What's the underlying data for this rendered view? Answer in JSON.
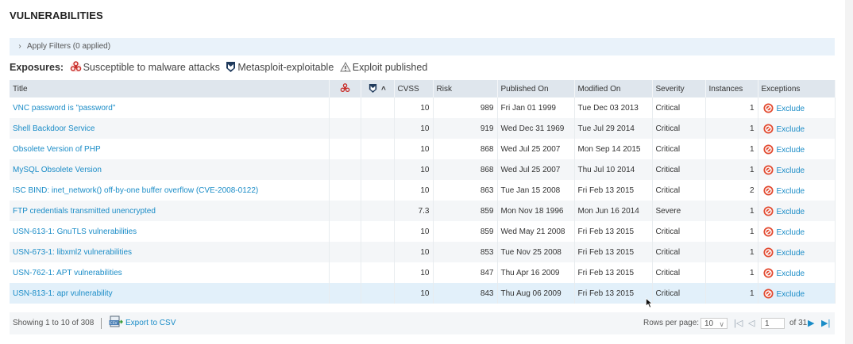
{
  "page": {
    "title": "VULNERABILITIES"
  },
  "filters": {
    "label": "Apply Filters (0 applied)"
  },
  "exposures": {
    "label": "Exposures:",
    "items": [
      {
        "icon": "malware-icon",
        "label": "Susceptible to malware attacks"
      },
      {
        "icon": "metasploit-icon",
        "label": "Metasploit-exploitable"
      },
      {
        "icon": "exploit-icon",
        "label": "Exploit published"
      }
    ]
  },
  "table": {
    "headers": {
      "title": "Title",
      "malware": "",
      "metasploit": "^",
      "cvss": "CVSS",
      "risk": "Risk",
      "published": "Published On",
      "modified": "Modified On",
      "severity": "Severity",
      "instances": "Instances",
      "exceptions": "Exceptions"
    },
    "rows": [
      {
        "title": "VNC password is \"password\"",
        "cvss": "10",
        "risk": "989",
        "published": "Fri Jan 01 1999",
        "modified": "Tue Dec 03 2013",
        "severity": "Critical",
        "instances": "1",
        "exception": "Exclude"
      },
      {
        "title": "Shell Backdoor Service",
        "cvss": "10",
        "risk": "919",
        "published": "Wed Dec 31 1969",
        "modified": "Tue Jul 29 2014",
        "severity": "Critical",
        "instances": "1",
        "exception": "Exclude"
      },
      {
        "title": "Obsolete Version of PHP",
        "cvss": "10",
        "risk": "868",
        "published": "Wed Jul 25 2007",
        "modified": "Mon Sep 14 2015",
        "severity": "Critical",
        "instances": "1",
        "exception": "Exclude"
      },
      {
        "title": "MySQL Obsolete Version",
        "cvss": "10",
        "risk": "868",
        "published": "Wed Jul 25 2007",
        "modified": "Thu Jul 10 2014",
        "severity": "Critical",
        "instances": "1",
        "exception": "Exclude"
      },
      {
        "title": "ISC BIND: inet_network() off-by-one buffer overflow (CVE-2008-0122)",
        "cvss": "10",
        "risk": "863",
        "published": "Tue Jan 15 2008",
        "modified": "Fri Feb 13 2015",
        "severity": "Critical",
        "instances": "2",
        "exception": "Exclude"
      },
      {
        "title": "FTP credentials transmitted unencrypted",
        "cvss": "7.3",
        "risk": "859",
        "published": "Mon Nov 18 1996",
        "modified": "Mon Jun 16 2014",
        "severity": "Severe",
        "instances": "1",
        "exception": "Exclude"
      },
      {
        "title": "USN-613-1: GnuTLS vulnerabilities",
        "cvss": "10",
        "risk": "859",
        "published": "Wed May 21 2008",
        "modified": "Fri Feb 13 2015",
        "severity": "Critical",
        "instances": "1",
        "exception": "Exclude"
      },
      {
        "title": "USN-673-1: libxml2 vulnerabilities",
        "cvss": "10",
        "risk": "853",
        "published": "Tue Nov 25 2008",
        "modified": "Fri Feb 13 2015",
        "severity": "Critical",
        "instances": "1",
        "exception": "Exclude"
      },
      {
        "title": "USN-762-1: APT vulnerabilities",
        "cvss": "10",
        "risk": "847",
        "published": "Thu Apr 16 2009",
        "modified": "Fri Feb 13 2015",
        "severity": "Critical",
        "instances": "1",
        "exception": "Exclude"
      },
      {
        "title": "USN-813-1: apr vulnerability",
        "cvss": "10",
        "risk": "843",
        "published": "Thu Aug 06 2009",
        "modified": "Fri Feb 13 2015",
        "severity": "Critical",
        "instances": "1",
        "exception": "Exclude"
      }
    ]
  },
  "footer": {
    "showing": "Showing 1 to 10 of 308",
    "export": "Export to CSV",
    "rows_per_page_label": "Rows per page:",
    "rows_per_page": "10",
    "current_page": "1",
    "of_pages": "of 31"
  },
  "colors": {
    "link": "#1a8cc7",
    "header_bg": "#dfe6ed",
    "filter_bg": "#e9f2fa",
    "exclude_icon": "#e2492f"
  }
}
